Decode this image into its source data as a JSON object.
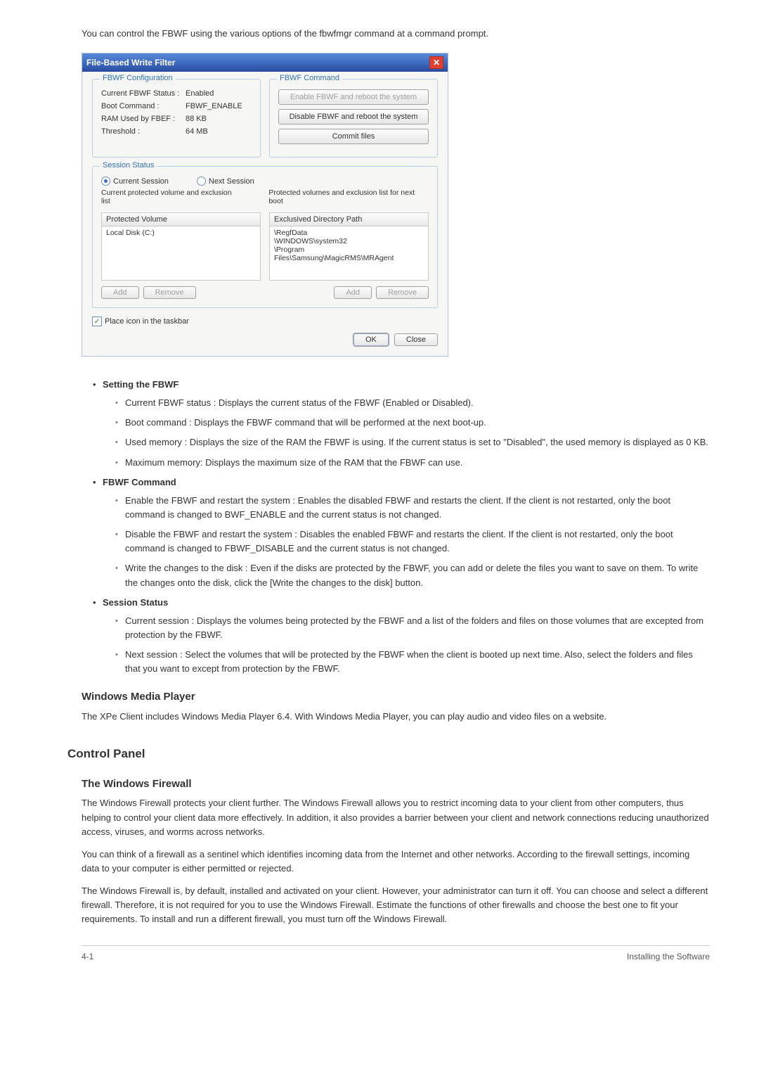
{
  "intro": "You can control the FBWF using the various options of the fbwfmgr command at a command prompt.",
  "dialog": {
    "title": "File-Based Write Filter",
    "config": {
      "legend": "FBWF Configuration",
      "status_label": "Current FBWF Status :",
      "status_value": "Enabled",
      "boot_label": "Boot Command :",
      "boot_value": "FBWF_ENABLE",
      "ram_label": "RAM Used by FBEF :",
      "ram_value": "88 KB",
      "threshold_label": "Threshold :",
      "threshold_value": "64 MB"
    },
    "command": {
      "legend": "FBWF Command",
      "enable": "Enable FBWF and reboot the system",
      "disable": "Disable FBWF and reboot the system",
      "commit": "Commit files"
    },
    "session": {
      "legend": "Session Status",
      "current_radio": "Current Session",
      "next_radio": "Next Session",
      "current_sub": "Current  protected volume and exclusion list",
      "next_sub": "Protected volumes and exclusion list for next boot",
      "protected_header": "Protected Volume",
      "protected_item": "Local Disk (C:)",
      "exclusived_header": "Exclusived Directory Path",
      "ex_path1": "\\RegfData",
      "ex_path2": "\\WINDOWS\\system32",
      "ex_path3": "\\Program Files\\Samsung\\MagicRMS\\MRAgent",
      "add": "Add",
      "remove": "Remove"
    },
    "place_icon": "Place icon in the taskbar",
    "ok": "OK",
    "close": "Close"
  },
  "doc": {
    "setting_title": "Setting the FBWF",
    "setting_items": [
      "Current FBWF status : Displays the current status of the FBWF (Enabled or Disabled).",
      "Boot command : Displays the FBWF command that will be performed at the next boot-up.",
      "Used memory : Displays the size of the RAM the FBWF is using. If the current status is set to \"Disabled\", the used memory is displayed as 0 KB.",
      "Maximum memory: Displays the maximum size of the RAM that the FBWF can use."
    ],
    "command_title": "FBWF Command",
    "command_items": [
      "Enable the FBWF and restart the system : Enables the disabled FBWF and restarts the client. If the client is not restarted, only the boot command is changed to BWF_ENABLE and the current status is not changed.",
      "Disable the FBWF and restart the system : Disables the enabled FBWF and restarts the client. If the client is not restarted, only the boot command is changed to FBWF_DISABLE and the current status is not changed.",
      "Write the changes to the disk : Even if the disks are protected by the FBWF, you can add or delete the files you want to save on them. To write the changes onto the disk, click the [Write the changes to the disk] button."
    ],
    "session_title": "Session Status",
    "session_items": [
      "Current session : Displays the volumes being protected by the FBWF and a list of the folders and files on those volumes that are excepted from protection by the FBWF.",
      "Next session : Select the volumes that will be protected by the FBWF when the client is booted up next time. Also, select the folders and files that you want to except from protection by the FBWF."
    ],
    "wmp_heading": "Windows Media Player",
    "wmp_para": "The XPe Client includes Windows Media Player 6.4. With Windows Media Player, you can play audio and video files on a website.",
    "cp_heading": "Control Panel",
    "fw_heading": "The Windows Firewall",
    "fw_p1": "The Windows Firewall protects your client further. The Windows Firewall allows you to restrict incoming data to your client from other computers, thus helping to control your client data more effectively. In addition, it also provides a barrier between your client and network connections reducing unauthorized access, viruses, and worms across networks.",
    "fw_p2": "You can think of a firewall as a sentinel which identifies incoming data from the Internet and other networks. According to the firewall settings, incoming data to your computer is either permitted or rejected.",
    "fw_p3": "The Windows Firewall is, by default, installed and activated on your client. However, your administrator can turn it off. You can choose and select a different firewall. Therefore, it is not required for you to use the Windows Firewall. Estimate the functions of other firewalls and choose the best one to fit your requirements. To install and run a different firewall, you must turn off the Windows Firewall."
  },
  "footer": {
    "left": "4-1",
    "right": "Installing the Software"
  }
}
